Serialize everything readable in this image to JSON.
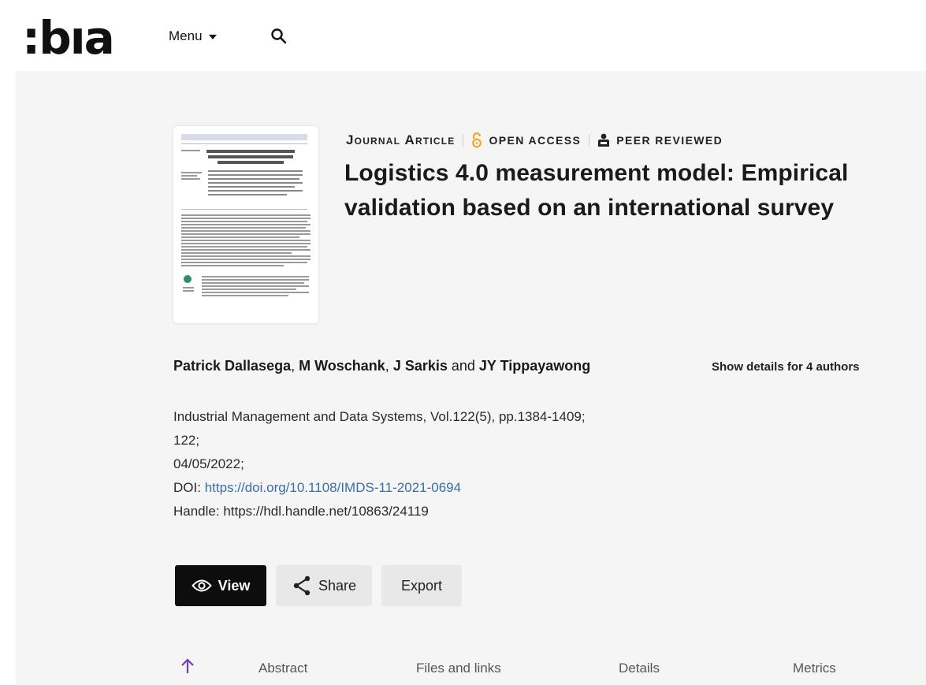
{
  "header": {
    "logo_text": ":bıa",
    "menu_label": "Menu",
    "search_icon": "search-icon"
  },
  "article": {
    "type_label": "Journal Article",
    "open_access_label": "open access",
    "peer_reviewed_label": "peer reviewed",
    "title": "Logistics 4.0 measurement model: Empirical validation based on an international survey",
    "authors": [
      {
        "name": "Patrick Dallasega",
        "sep": ", "
      },
      {
        "name": "M Woschank",
        "sep": ", "
      },
      {
        "name": "J Sarkis",
        "sep": " and "
      },
      {
        "name": "JY Tippayawong",
        "sep": ""
      }
    ],
    "show_details": "Show details for 4 authors",
    "journal_line": "Industrial Management and Data Systems, Vol.122(5), pp.1384-1409;",
    "volume_line": "122;",
    "date_line": "04/05/2022;",
    "doi_label": "DOI:",
    "doi_url": "https://doi.org/10.1108/IMDS-11-2021-0694",
    "handle_line": "Handle: https://hdl.handle.net/10863/24119"
  },
  "actions": {
    "view_label": "View",
    "share_label": "Share",
    "export_label": "Export"
  },
  "tabs": {
    "abstract": "Abstract",
    "files": "Files and links",
    "details": "Details",
    "metrics": "Metrics"
  },
  "colors": {
    "open_access": "#f5a623",
    "link": "#3a6ea5",
    "tab_arrow": "#6a3fc0"
  }
}
